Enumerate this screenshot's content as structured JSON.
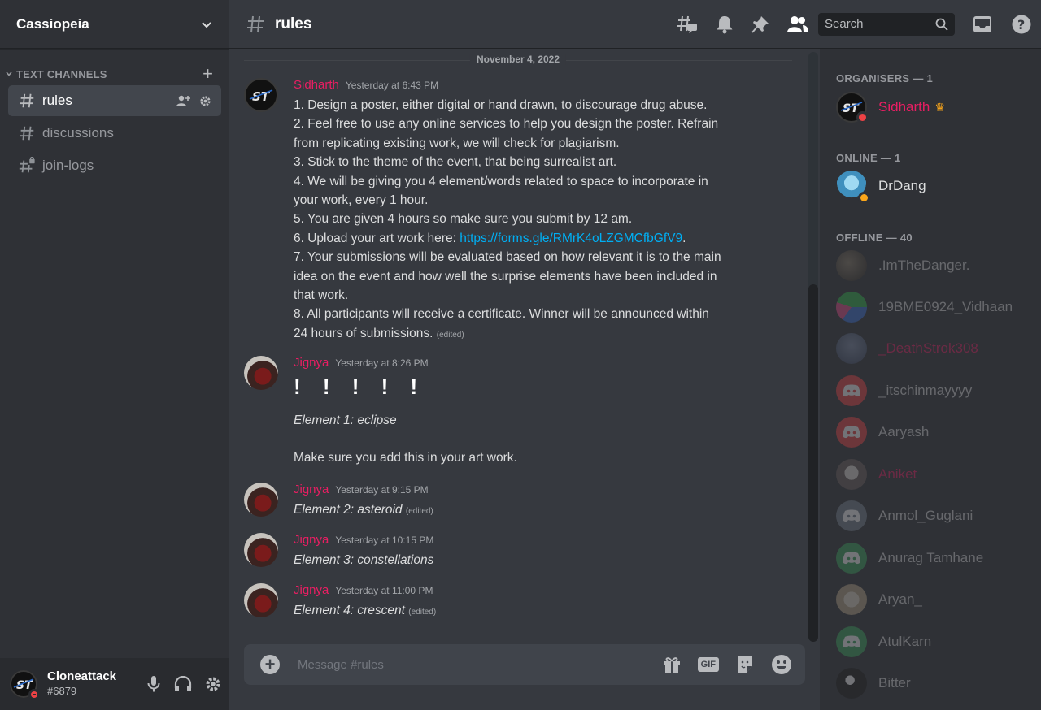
{
  "server": {
    "name": "Cassiopeia"
  },
  "sidebar": {
    "category": "TEXT CHANNELS",
    "channels": [
      {
        "label": "rules",
        "active": true
      },
      {
        "label": "discussions",
        "active": false
      },
      {
        "label": "join-logs",
        "active": false
      }
    ]
  },
  "user_panel": {
    "name": "Cloneattack",
    "tag": "#6879"
  },
  "header": {
    "channel": "rules",
    "search_placeholder": "Search"
  },
  "chat": {
    "date_divider": "November 4, 2022",
    "messages": [
      {
        "author": "Sidharth",
        "timestamp": "Yesterday at 6:43 PM",
        "lines": [
          "1. Design a poster, either digital or hand drawn, to discourage drug abuse.",
          "2. Feel free to use any online services to help you design the poster. Refrain",
          "from replicating existing work, we will check for plagiarism.",
          "3. Stick to the theme of the event, that being surrealist art.",
          "4. We will be giving you 4 element/words related to space to incorporate in",
          "your work, every 1 hour.",
          "5. You are given 4 hours so make sure you submit by 12 am.",
          "6. Upload your art work here: ",
          "7. Your submissions will be evaluated based on how relevant it is to the main",
          "idea on the event and how well the surprise elements have been included in",
          "that work.",
          "8. All participants will receive a certificate. Winner will be announced within",
          "24 hours of submissions."
        ],
        "link": "https://forms.gle/RMrK4oLZGMCfbGfV9",
        "link_suffix": ".",
        "edited": "(edited)"
      },
      {
        "author": "Jignya",
        "timestamp": "Yesterday at 8:26 PM",
        "emphasis": "! ! ! ! !",
        "element": "Element 1: eclipse",
        "note": "Make sure you add this in your art work."
      },
      {
        "author": "Jignya",
        "timestamp": "Yesterday at 9:15 PM",
        "text": "Element 2: asteroid",
        "edited": "(edited)"
      },
      {
        "author": "Jignya",
        "timestamp": "Yesterday at 10:15 PM",
        "text": "Element 3: constellations"
      },
      {
        "author": "Jignya",
        "timestamp": "Yesterday at 11:00 PM",
        "text": "Element 4: crescent",
        "edited": "(edited)"
      }
    ]
  },
  "composer": {
    "placeholder": "Message #rules",
    "gif_label": "GIF"
  },
  "members": {
    "organisers_header": "ORGANISERS — 1",
    "online_header": "ONLINE — 1",
    "offline_header": "OFFLINE — 40",
    "organisers": [
      "Sidharth"
    ],
    "online": [
      "DrDang"
    ],
    "offline": [
      ".ImTheDanger.",
      "19BME0924_Vidhaan",
      "_DeathStrok308",
      "_itschinmayyyy",
      "Aaryash",
      "Aniket",
      "Anmol_Guglani",
      "Anurag Tamhane",
      "Aryan_",
      "AtulKarn",
      "Bitter"
    ]
  },
  "colors": {
    "accent": "#e91e63",
    "link": "#00aff4",
    "dnd": "#ed4245",
    "idle": "#faa61a"
  }
}
